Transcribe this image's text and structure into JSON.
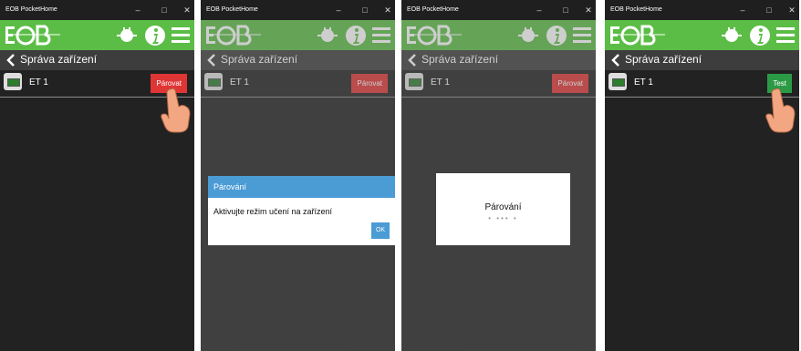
{
  "app_title": "EOB PocketHome",
  "window_controls": {
    "minimize": "–",
    "maximize": "□",
    "close": "✕"
  },
  "header_icons": [
    "plug-icon",
    "info-icon",
    "menu-icon"
  ],
  "nav_title": "Správa zařízení",
  "device": {
    "name": "ET 1"
  },
  "buttons": {
    "pair": "Párovat",
    "test": "Test"
  },
  "dialog": {
    "title": "Párování",
    "message": "Aktivujte režim učení na zařízení",
    "ok": "OK"
  },
  "progress": {
    "title": "Párování",
    "dots": "• •••  •"
  },
  "colors": {
    "green_bar": "#5bbd46",
    "pair_button": "#e03535",
    "test_button": "#2b9a45",
    "dialog_header": "#4b9bd5"
  }
}
